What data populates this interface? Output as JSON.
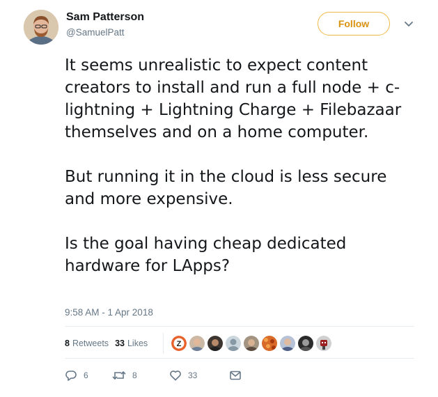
{
  "author": {
    "name": "Sam Patterson",
    "handle": "@SamuelPatt"
  },
  "follow_button": {
    "label": "Follow",
    "color": "#f0b847"
  },
  "tweet": {
    "paragraphs": [
      "It seems unrealistic to expect content creators to install and run a full node + c-lightning + Lightning Charge + Filebazaar themselves and on a home computer.",
      "But running it in the cloud is less secure and more expensive.",
      "Is the goal having cheap dedicated hardware for LApps?"
    ],
    "timestamp": "9:58 AM - 1 Apr 2018"
  },
  "stats": {
    "retweets_count": "8",
    "retweets_label": "Retweets",
    "likes_count": "33",
    "likes_label": "Likes"
  },
  "likers": [
    {
      "icon": "z-logo-avatar",
      "color": "#e8622c"
    },
    {
      "icon": "person-avatar",
      "color": "#b9a08a"
    },
    {
      "icon": "person-avatar",
      "color": "#5a4a3e"
    },
    {
      "icon": "default-avatar",
      "color": "#c2ccd4"
    },
    {
      "icon": "person-avatar",
      "color": "#8d7a66"
    },
    {
      "icon": "pattern-avatar",
      "color": "#d86a2a"
    },
    {
      "icon": "person-avatar",
      "color": "#8a96b4"
    },
    {
      "icon": "person-avatar",
      "color": "#333333"
    },
    {
      "icon": "robot-avatar",
      "color": "#9b2020"
    }
  ],
  "actions": {
    "reply_count": "6",
    "retweet_count": "8",
    "like_count": "33"
  },
  "icons": [
    "chevron-down-icon",
    "reply-icon",
    "retweet-icon",
    "heart-icon",
    "message-icon"
  ]
}
